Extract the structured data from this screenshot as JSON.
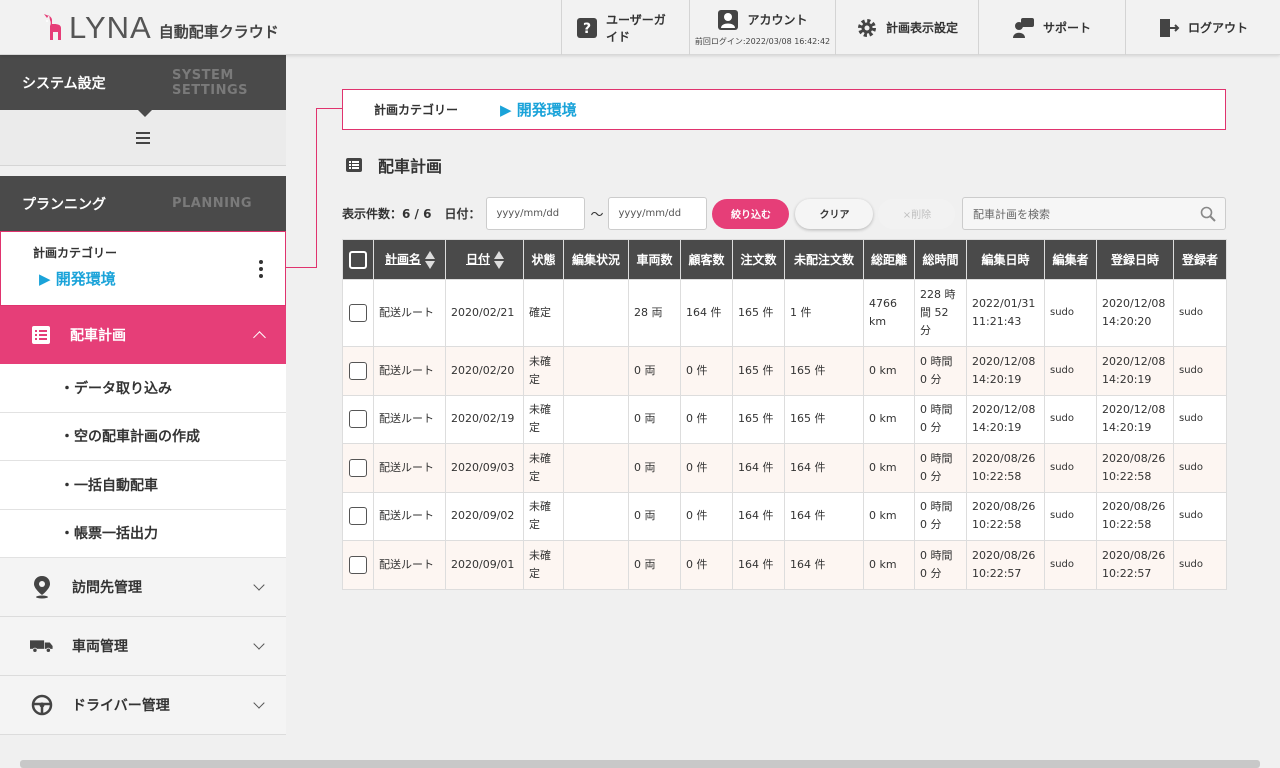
{
  "header": {
    "logo_text": "LYNA",
    "logo_sub": "自動配車クラウド",
    "nav": {
      "guide": "ユーザーガイド",
      "account": "アカウント",
      "last_login": "前回ログイン:2022/03/08 16:42:42",
      "display_settings": "計画表示設定",
      "support": "サポート",
      "logout": "ログアウト"
    }
  },
  "sidebar": {
    "system": {
      "jp": "システム設定",
      "en_line1": "SYSTEM",
      "en_line2": "SETTINGS"
    },
    "planning": {
      "jp": "プランニング",
      "en": "PLANNING"
    },
    "category": {
      "label": "計画カテゴリー",
      "value": "▶ 開発環境"
    },
    "active_menu": "配車計画",
    "sub_items": [
      "・データ取り込み",
      "・空の配車計画の作成",
      "・一括自動配車",
      "・帳票一括出力"
    ],
    "menus": [
      "訪問先管理",
      "車両管理",
      "ドライバー管理"
    ]
  },
  "main": {
    "category_label": "計画カテゴリー",
    "category_value": "▶ 開発環境",
    "title": "配車計画",
    "toolbar": {
      "count_label": "表示件数：6 / 6",
      "date_label": "日付：",
      "date_from_placeholder": "yyyy/mm/dd",
      "date_to_placeholder": "yyyy/mm/dd",
      "tilde": "〜",
      "filter_button": "絞り込む",
      "clear_button": "クリア",
      "delete_button": "×削除",
      "search_placeholder": "配車計画を検索"
    },
    "table": {
      "headers": [
        "計画名",
        "日付",
        "状態",
        "編集状況",
        "車両数",
        "顧客数",
        "注文数",
        "未配注文数",
        "総距離",
        "総時間",
        "編集日時",
        "編集者",
        "登録日時",
        "登録者"
      ],
      "rows": [
        [
          "配送ルート",
          "2020/02/21",
          "確定",
          "",
          "28 両",
          "164 件",
          "165 件",
          "1 件",
          "4766 km",
          "228 時間 52 分",
          "2022/01/31 11:21:43",
          "sudo",
          "2020/12/08 14:20:20",
          "sudo"
        ],
        [
          "配送ルート",
          "2020/02/20",
          "未確定",
          "",
          "0 両",
          "0 件",
          "165 件",
          "165 件",
          "0 km",
          "0 時間 0 分",
          "2020/12/08 14:20:19",
          "sudo",
          "2020/12/08 14:20:19",
          "sudo"
        ],
        [
          "配送ルート",
          "2020/02/19",
          "未確定",
          "",
          "0 両",
          "0 件",
          "165 件",
          "165 件",
          "0 km",
          "0 時間 0 分",
          "2020/12/08 14:20:19",
          "sudo",
          "2020/12/08 14:20:19",
          "sudo"
        ],
        [
          "配送ルート",
          "2020/09/03",
          "未確定",
          "",
          "0 両",
          "0 件",
          "164 件",
          "164 件",
          "0 km",
          "0 時間 0 分",
          "2020/08/26 10:22:58",
          "sudo",
          "2020/08/26 10:22:58",
          "sudo"
        ],
        [
          "配送ルート",
          "2020/09/02",
          "未確定",
          "",
          "0 両",
          "0 件",
          "164 件",
          "164 件",
          "0 km",
          "0 時間 0 分",
          "2020/08/26 10:22:58",
          "sudo",
          "2020/08/26 10:22:58",
          "sudo"
        ],
        [
          "配送ルート",
          "2020/09/01",
          "未確定",
          "",
          "0 両",
          "0 件",
          "164 件",
          "164 件",
          "0 km",
          "0 時間 0 分",
          "2020/08/26 10:22:57",
          "sudo",
          "2020/08/26 10:22:57",
          "sudo"
        ]
      ]
    }
  },
  "colors": {
    "accent": "#e63e78",
    "link": "#1aa3d9",
    "dark": "#4a4a4a"
  }
}
